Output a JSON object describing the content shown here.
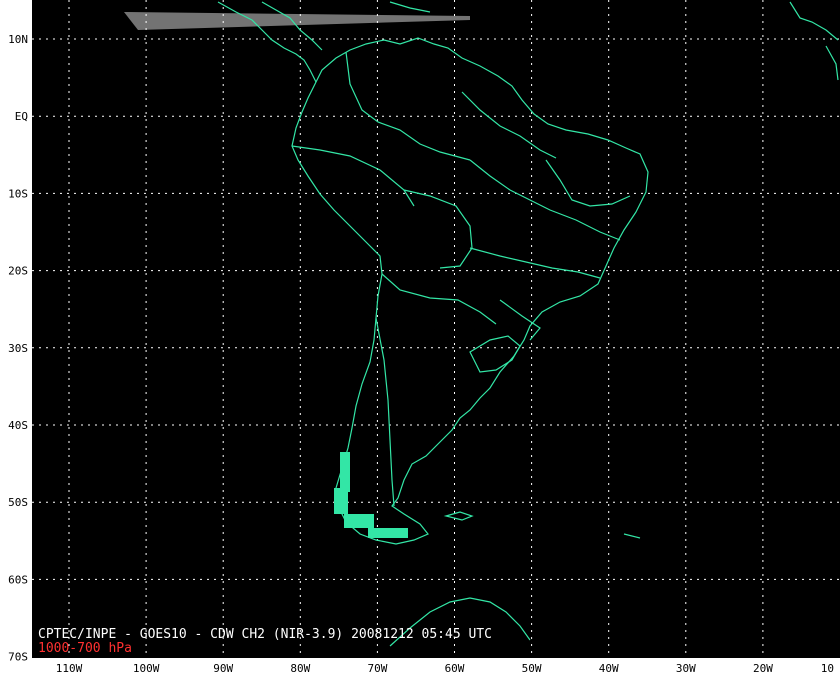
{
  "map": {
    "caption_line1": "CPTEC/INPE - GOES10 - CDW CH2 (NIR-3.9) 20081212 05:45 UTC",
    "caption_line2": "1000-700 hPa",
    "caption_line1_color": "#ffffff",
    "caption_line2_color": "#ff3030",
    "background_color": "#000000",
    "coast_color": "#33e6a6",
    "grid_color": "#ffffff",
    "lat_labels": [
      "10N",
      "EQ",
      "10S",
      "20S",
      "30S",
      "40S",
      "50S",
      "60S",
      "70S"
    ],
    "lon_labels": [
      "110W",
      "100W",
      "90W",
      "80W",
      "70W",
      "60W",
      "50W",
      "40W",
      "30W",
      "20W",
      "10"
    ]
  }
}
